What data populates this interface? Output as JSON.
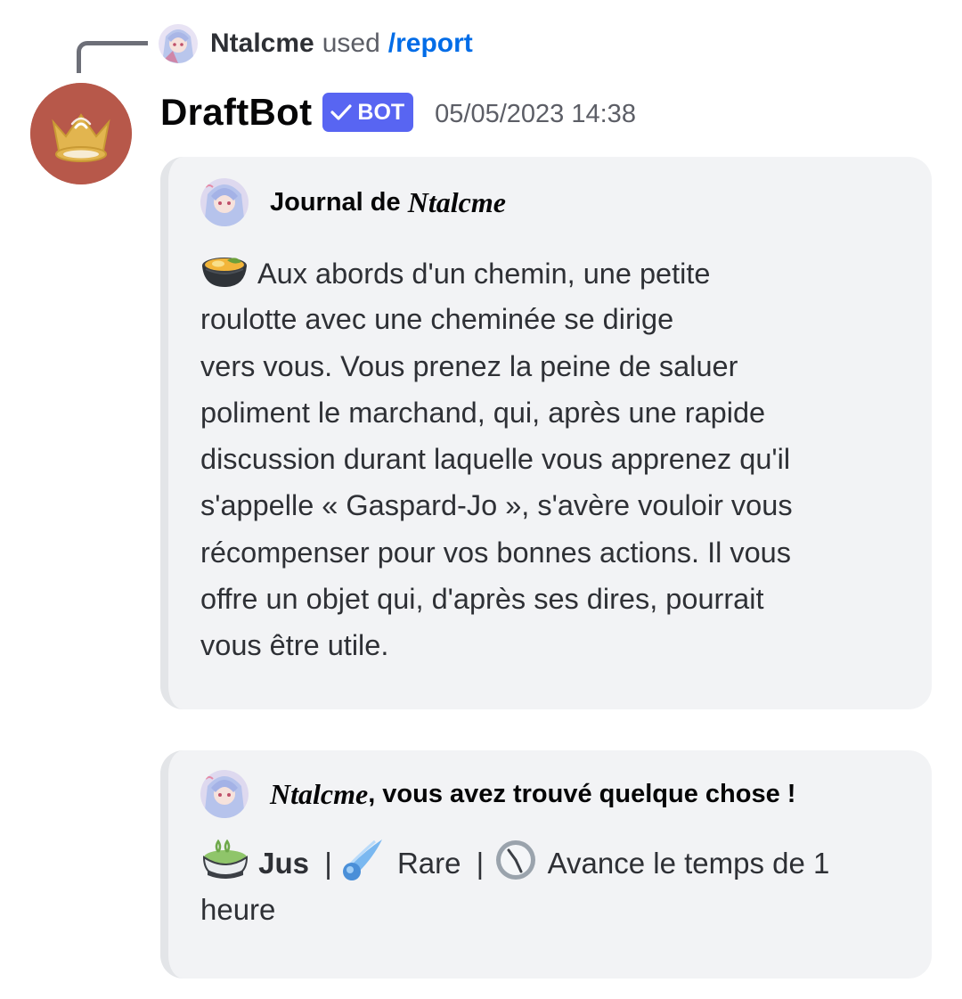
{
  "reply": {
    "user": "Ntalcme",
    "used": "used",
    "command": "/report"
  },
  "message": {
    "author": "DraftBot",
    "tag": "BOT",
    "timestamp": "05/05/2023 14:38"
  },
  "embed_report": {
    "author_prefix": "Journal de",
    "author_name": "Ntalcme",
    "emoji": "ramen-bowl-icon",
    "lines": [
      "Aux abords d'un chemin, une petite",
      "roulotte avec une cheminée se dirige",
      "vers vous. Vous prenez la peine de saluer",
      "poliment le marchand, qui, après une rapide",
      "discussion durant laquelle vous apprenez qu'il",
      "s'appelle « Gaspard-Jo », s'avère vouloir vous",
      "récompenser pour vos bonnes actions. Il vous",
      "offre un objet qui, d'après ses dires, pourrait",
      "vous être utile."
    ]
  },
  "embed_loot": {
    "author_name": "Ntalcme",
    "author_suffix": ", vous avez trouvé quelque chose !",
    "item_name": "Jus",
    "separator": "|",
    "rarity": "Rare",
    "effect_line1": "Avance le temps de 1",
    "effect_line2": "heure",
    "icons": [
      "tea-cup-icon",
      "comet-icon",
      "clock-icon"
    ]
  },
  "colors": {
    "bot_tag": "#5865f2",
    "command_link": "#006ce7",
    "bot_avatar": "#b7584a",
    "embed_bg": "#f2f3f5"
  }
}
